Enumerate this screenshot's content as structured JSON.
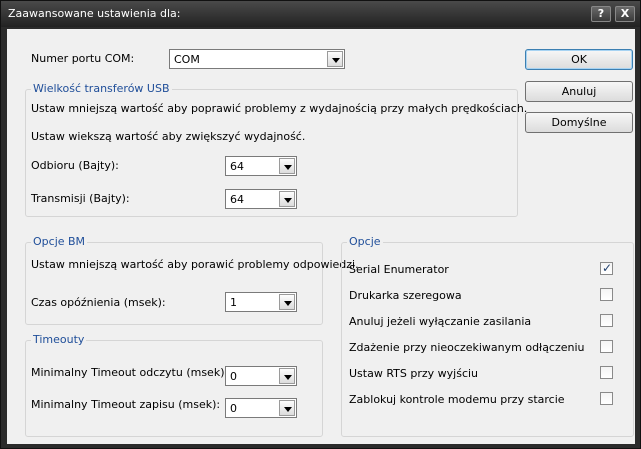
{
  "window": {
    "title": "Zaawansowane ustawienia dla:",
    "help_button": "?",
    "close_button": "X"
  },
  "com_port": {
    "label": "Numer portu COM:",
    "value": "COM"
  },
  "usb": {
    "title": "Wielkość transferów USB",
    "hint_small": "Ustaw mniejszą wartość aby poprawić problemy z wydajnością przy małych prędkościach.",
    "hint_large": "Ustaw wiekszą wartość aby zwiększyć wydajność.",
    "receive_label": "Odbioru (Bajty):",
    "receive_value": "64",
    "transmit_label": "Transmisji (Bajty):",
    "transmit_value": "64"
  },
  "bm": {
    "title": "Opcje BM",
    "hint": "Ustaw mniejszą wartość aby porawić problemy odpowiedzi.",
    "latency_label": "Czas opóźnienia (msek):",
    "latency_value": "1"
  },
  "timeouts": {
    "title": "Timeouty",
    "read_label": "Minimalny Timeout odczytu (msek):",
    "read_value": "0",
    "write_label": "Minimalny Timeout zapisu (msek):",
    "write_value": "0"
  },
  "options": {
    "title": "Opcje",
    "items": [
      {
        "label": "Serial Enumerator",
        "checked": true
      },
      {
        "label": "Drukarka szeregowa",
        "checked": false
      },
      {
        "label": "Anuluj jeżeli wyłączanie zasilania",
        "checked": false
      },
      {
        "label": "Zdażenie przy nieoczekiwanym odłączeniu",
        "checked": false
      },
      {
        "label": "Ustaw RTS przy wyjściu",
        "checked": false
      },
      {
        "label": "Zablokuj kontrole modemu przy starcie",
        "checked": false
      }
    ]
  },
  "buttons": {
    "ok": "OK",
    "cancel": "Anuluj",
    "defaults": "Domyślne"
  }
}
